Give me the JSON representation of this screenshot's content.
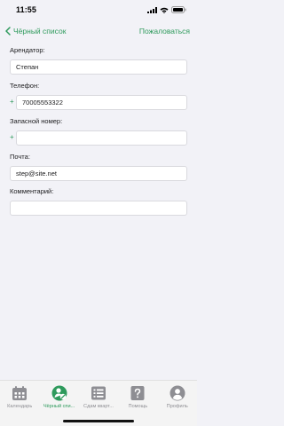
{
  "status": {
    "time": "11:55",
    "signal_icon": "signal-bars-icon",
    "wifi_icon": "wifi-icon",
    "battery_icon": "battery-icon"
  },
  "nav": {
    "back_label": "Чёрный список",
    "back_icon": "chevron-left-icon",
    "action_label": "Пожаловаться",
    "accent": "#2e9a5c"
  },
  "form": {
    "tenant": {
      "label": "Арендатор:",
      "value": "Степан"
    },
    "phone": {
      "label": "Телефон:",
      "prefix": "+",
      "value": "70005553322"
    },
    "backup_phone": {
      "label": "Запасной номер:",
      "prefix": "+",
      "value": ""
    },
    "email": {
      "label": "Почта:",
      "value": "step@site.net"
    },
    "comment": {
      "label": "Комментарий:",
      "value": ""
    }
  },
  "tabs": [
    {
      "label": "Календарь",
      "icon": "calendar-icon",
      "active": false
    },
    {
      "label": "Чёрный спи...",
      "icon": "blacklist-icon",
      "active": true
    },
    {
      "label": "Сдам кварт...",
      "icon": "list-icon",
      "active": false
    },
    {
      "label": "Помощь",
      "icon": "help-icon",
      "active": false
    },
    {
      "label": "Профиль",
      "icon": "profile-icon",
      "active": false
    }
  ]
}
